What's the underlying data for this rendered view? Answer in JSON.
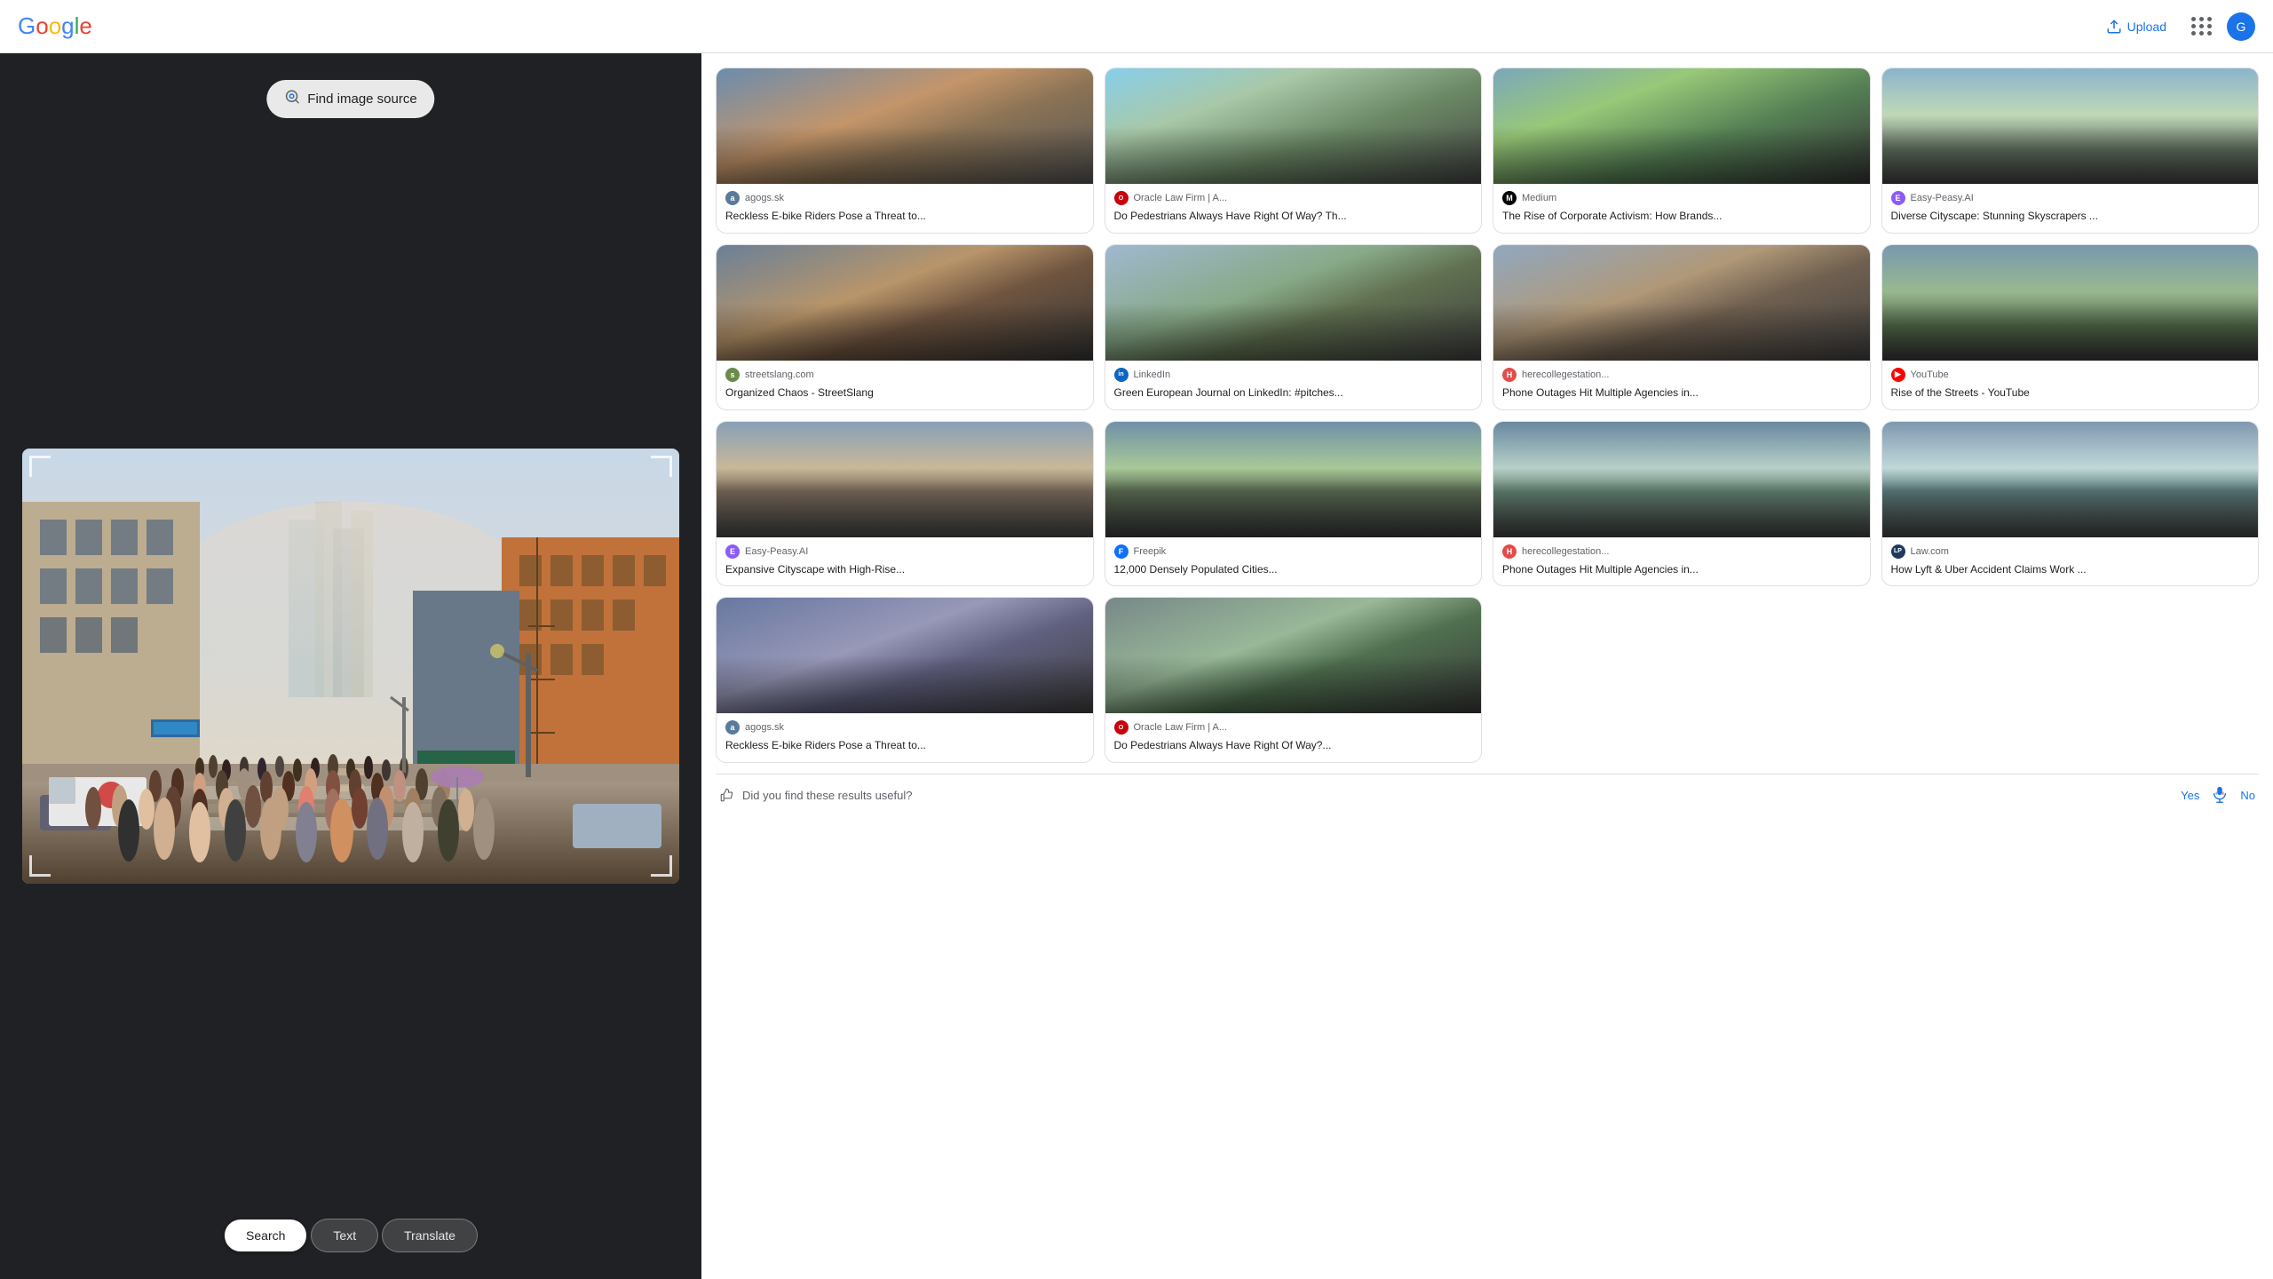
{
  "header": {
    "logo_letters": [
      {
        "letter": "G",
        "color": "g-blue"
      },
      {
        "letter": "o",
        "color": "g-red"
      },
      {
        "letter": "o",
        "color": "g-yellow"
      },
      {
        "letter": "g",
        "color": "g-blue"
      },
      {
        "letter": "l",
        "color": "g-green"
      },
      {
        "letter": "e",
        "color": "g-red"
      }
    ],
    "upload_label": "Upload",
    "avatar_letter": "G"
  },
  "left_panel": {
    "find_image_label": "Find image source",
    "tabs": [
      {
        "label": "Search",
        "active": true
      },
      {
        "label": "Text",
        "active": false
      },
      {
        "label": "Translate",
        "active": false
      }
    ]
  },
  "right_panel": {
    "results": [
      {
        "id": 1,
        "thumb_class": "thumb-1",
        "favicon_class": "fav-agogs",
        "favicon_letter": "a",
        "source": "agogs.sk",
        "title": "Reckless E-bike Riders Pose a Threat to..."
      },
      {
        "id": 2,
        "thumb_class": "thumb-2",
        "favicon_class": "fav-oracle",
        "favicon_letter": "O",
        "source": "Oracle Law Firm | A...",
        "title": "Do Pedestrians Always Have Right Of Way? Th..."
      },
      {
        "id": 3,
        "thumb_class": "thumb-3",
        "favicon_class": "fav-medium",
        "favicon_letter": "M",
        "source": "Medium",
        "title": "The Rise of Corporate Activism: How Brands..."
      },
      {
        "id": 4,
        "thumb_class": "thumb-4",
        "favicon_class": "fav-easypeasy",
        "favicon_letter": "E",
        "source": "Easy-Peasy.AI",
        "title": "Diverse Cityscape: Stunning Skyscrapers ..."
      },
      {
        "id": 5,
        "thumb_class": "thumb-5",
        "favicon_class": "fav-streetslang",
        "favicon_letter": "s",
        "source": "streetslang.com",
        "title": "Organized Chaos - StreetSlang"
      },
      {
        "id": 6,
        "thumb_class": "thumb-6",
        "favicon_class": "fav-linkedin",
        "favicon_letter": "in",
        "source": "LinkedIn",
        "title": "Green European Journal on LinkedIn: #pitches..."
      },
      {
        "id": 7,
        "thumb_class": "thumb-7",
        "favicon_class": "fav-herecollegse",
        "favicon_letter": "H",
        "source": "herecollegestation...",
        "title": "Phone Outages Hit Multiple Agencies in..."
      },
      {
        "id": 8,
        "thumb_class": "thumb-8",
        "favicon_class": "fav-youtube",
        "favicon_letter": "▶",
        "source": "YouTube",
        "title": "Rise of the Streets - YouTube"
      },
      {
        "id": 9,
        "thumb_class": "thumb-9",
        "favicon_class": "fav-easypeasy",
        "favicon_letter": "E",
        "source": "Easy-Peasy.AI",
        "title": "Expansive Cityscape with High-Rise..."
      },
      {
        "id": 10,
        "thumb_class": "thumb-10",
        "favicon_class": "fav-freepik",
        "favicon_letter": "F",
        "source": "Freepik",
        "title": "12,000 Densely Populated Cities..."
      },
      {
        "id": 11,
        "thumb_class": "thumb-11",
        "favicon_class": "fav-herecollegse",
        "favicon_letter": "H",
        "source": "herecollegestation...",
        "title": "Phone Outages Hit Multiple Agencies in..."
      },
      {
        "id": 12,
        "thumb_class": "thumb-12",
        "favicon_class": "fav-lawcom",
        "favicon_letter": "LP",
        "source": "Law.com",
        "title": "How Lyft & Uber Accident Claims Work ..."
      },
      {
        "id": 13,
        "thumb_class": "thumb-13",
        "favicon_class": "fav-agogs",
        "favicon_letter": "a",
        "source": "agogs.sk",
        "title": "Reckless E-bike Riders Pose a Threat to..."
      },
      {
        "id": 14,
        "thumb_class": "thumb-14",
        "favicon_class": "fav-oracle",
        "favicon_letter": "O",
        "source": "Oracle Law Firm | A...",
        "title": "Do Pedestrians Always Have Right Of Way?..."
      }
    ],
    "feedback": {
      "question": "Did you find these results useful?",
      "yes_label": "Yes",
      "no_label": "No"
    }
  }
}
